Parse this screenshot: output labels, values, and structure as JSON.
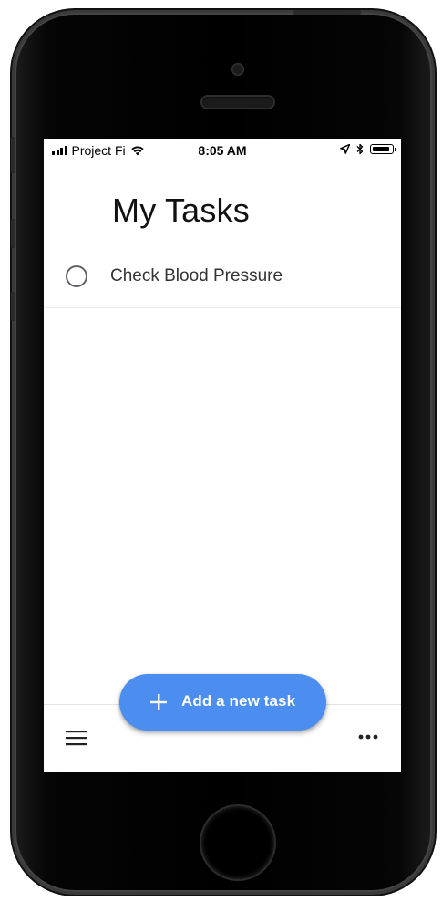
{
  "status_bar": {
    "carrier": "Project Fi",
    "time": "8:05 AM",
    "battery_level": 0.9
  },
  "page": {
    "title": "My Tasks"
  },
  "tasks": [
    {
      "label": "Check Blood Pressure",
      "completed": false
    }
  ],
  "fab": {
    "label": "Add a new task",
    "color": "#4b8ef0"
  },
  "icons": {
    "menu": "hamburger-menu-icon",
    "more": "more-horizontal-icon",
    "add": "plus-icon"
  }
}
